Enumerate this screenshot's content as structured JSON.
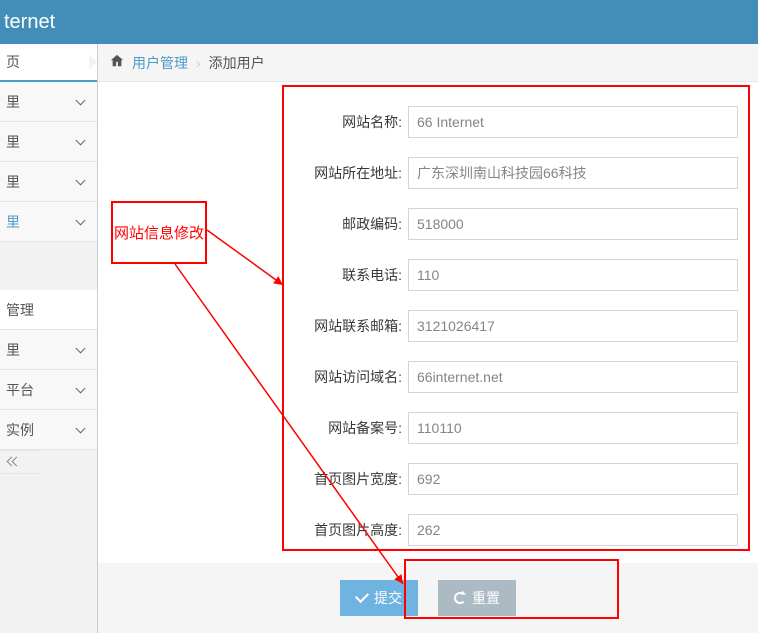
{
  "topbar": {
    "title": "ternet"
  },
  "sidebar": {
    "page_tab": "页",
    "items": [
      {
        "label": "里"
      },
      {
        "label": "里"
      },
      {
        "label": "里"
      },
      {
        "label": "里"
      },
      {
        "label": "管理"
      },
      {
        "label": "里"
      },
      {
        "label": "平台"
      },
      {
        "label": "实例"
      }
    ]
  },
  "breadcrumb": {
    "link": "用户管理",
    "current": "添加用户"
  },
  "form": {
    "fields": [
      {
        "label": "网站名称:",
        "value": "66 Internet"
      },
      {
        "label": "网站所在地址:",
        "value": "广东深圳南山科技园66科技"
      },
      {
        "label": "邮政编码:",
        "value": "518000"
      },
      {
        "label": "联系电话:",
        "value": "110"
      },
      {
        "label": "网站联系邮箱:",
        "value": "3121026417"
      },
      {
        "label": "网站访问域名:",
        "value": "66internet.net"
      },
      {
        "label": "网站备案号:",
        "value": "110110"
      },
      {
        "label": "首页图片宽度:",
        "value": "692"
      },
      {
        "label": "首页图片高度:",
        "value": "262"
      }
    ],
    "submit_label": "提交",
    "reset_label": "重置"
  },
  "annotation": {
    "label": "网站信息修改"
  }
}
